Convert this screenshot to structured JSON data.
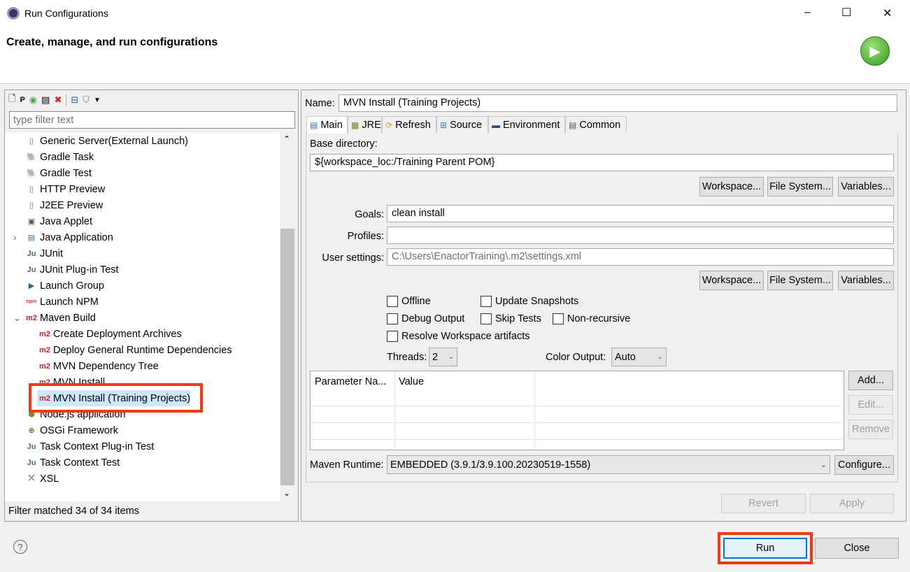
{
  "window": {
    "title": "Run Configurations",
    "minimize": "–",
    "maximize": "☐",
    "close": "✕"
  },
  "header": {
    "title": "Create, manage, and run configurations"
  },
  "left": {
    "filter_placeholder": "type filter text",
    "toolbar": [
      "new-config-icon",
      "new-prototype-icon",
      "duplicate-icon",
      "copy-icon",
      "delete-icon",
      "collapse-all-icon",
      "filter-icon",
      "dropdown-icon"
    ],
    "items": [
      {
        "label": "Generic Server(External Launch)",
        "level": 1,
        "icon": "server-icon",
        "glyph": "▯",
        "color": "#5a8a3a"
      },
      {
        "label": "Gradle Task",
        "level": 1,
        "icon": "gradle-elephant-icon",
        "glyph": "🐘",
        "color": "#02303a"
      },
      {
        "label": "Gradle Test",
        "level": 1,
        "icon": "gradle-elephant-icon",
        "glyph": "🐘",
        "color": "#1ba8cb"
      },
      {
        "label": "HTTP Preview",
        "level": 1,
        "icon": "server-icon",
        "glyph": "▯",
        "color": "#5a8a3a"
      },
      {
        "label": "J2EE Preview",
        "level": 1,
        "icon": "server-icon",
        "glyph": "▯",
        "color": "#5a8a3a"
      },
      {
        "label": "Java Applet",
        "level": 1,
        "icon": "applet-icon",
        "glyph": "▣",
        "color": "#555"
      },
      {
        "label": "Java Application",
        "level": 1,
        "icon": "java-app-icon",
        "glyph": "▤",
        "color": "#3a6ea5",
        "expander": "›"
      },
      {
        "label": "JUnit",
        "level": 1,
        "icon": "junit-icon",
        "glyph": "Ju",
        "color": "#3a6ea5"
      },
      {
        "label": "JUnit Plug-in Test",
        "level": 1,
        "icon": "junit-plugin-icon",
        "glyph": "Ju",
        "color": "#3a6ea5"
      },
      {
        "label": "Launch Group",
        "level": 1,
        "icon": "launch-group-icon",
        "glyph": "▶",
        "color": "#2a6a9a"
      },
      {
        "label": "Launch NPM",
        "level": 1,
        "icon": "npm-icon",
        "glyph": "npm",
        "color": "#cb3837"
      },
      {
        "label": "Maven Build",
        "level": 1,
        "icon": "maven-icon",
        "glyph": "m2",
        "color": "#d0202a",
        "expander": "⌄"
      },
      {
        "label": "Create Deployment Archives",
        "level": 2,
        "icon": "maven-icon",
        "glyph": "m2",
        "color": "#d0202a"
      },
      {
        "label": "Deploy General Runtime Dependencies",
        "level": 2,
        "icon": "maven-icon",
        "glyph": "m2",
        "color": "#d0202a"
      },
      {
        "label": "MVN Dependency Tree",
        "level": 2,
        "icon": "maven-icon",
        "glyph": "m2",
        "color": "#d0202a"
      },
      {
        "label": "MVN Install",
        "level": 2,
        "icon": "maven-icon",
        "glyph": "m2",
        "color": "#d0202a"
      },
      {
        "label": "MVN Install (Training Projects)",
        "level": 2,
        "icon": "maven-icon",
        "glyph": "m2",
        "color": "#d0202a",
        "selected": true
      },
      {
        "label": "Node.js application",
        "level": 1,
        "icon": "nodejs-icon",
        "glyph": "⬢",
        "color": "#6a9a2a"
      },
      {
        "label": "OSGi Framework",
        "level": 1,
        "icon": "osgi-icon",
        "glyph": "⊕",
        "color": "#8a5a2a"
      },
      {
        "label": "Task Context Plug-in Test",
        "level": 1,
        "icon": "task-context-plugin-icon",
        "glyph": "Ju",
        "color": "#3a6ea5"
      },
      {
        "label": "Task Context Test",
        "level": 1,
        "icon": "task-context-icon",
        "glyph": "Ju",
        "color": "#3a6ea5"
      },
      {
        "label": "XSL",
        "level": 1,
        "icon": "xsl-icon",
        "glyph": "⤫",
        "color": "#444"
      }
    ],
    "status": "Filter matched 34 of 34 items"
  },
  "right": {
    "name_label": "Name:",
    "name_value": "MVN Install (Training Projects)",
    "tabs": [
      {
        "label": "Main",
        "icon": "main-tab-icon"
      },
      {
        "label": "JRE",
        "icon": "jre-icon"
      },
      {
        "label": "Refresh",
        "icon": "refresh-icon"
      },
      {
        "label": "Source",
        "icon": "source-icon"
      },
      {
        "label": "Environment",
        "icon": "environment-icon"
      },
      {
        "label": "Common",
        "icon": "common-icon"
      }
    ],
    "base_dir_label": "Base directory:",
    "base_dir_value": "${workspace_loc:/Training Parent POM}",
    "workspace_btn": "Workspace...",
    "filesystem_btn": "File System...",
    "variables_btn": "Variables...",
    "goals_label": "Goals:",
    "goals_value": "clean install",
    "profiles_label": "Profiles:",
    "profiles_value": "",
    "user_settings_label": "User settings:",
    "user_settings_value": "C:\\Users\\EnactorTraining\\.m2\\settings.xml",
    "checkboxes": {
      "offline": "Offline",
      "update_snapshots": "Update Snapshots",
      "debug_output": "Debug Output",
      "skip_tests": "Skip Tests",
      "non_recursive": "Non-recursive",
      "resolve_workspace": "Resolve Workspace artifacts"
    },
    "threads_label": "Threads:",
    "threads_value": "2",
    "color_output_label": "Color Output:",
    "color_output_value": "Auto",
    "params_headers": [
      "Parameter Na...",
      "Value"
    ],
    "add_btn": "Add...",
    "edit_btn": "Edit...",
    "remove_btn": "Remove",
    "maven_runtime_label": "Maven Runtime:",
    "maven_runtime_value": "EMBEDDED (3.9.1/3.9.100.20230519-1558)",
    "configure_btn": "Configure...",
    "revert_btn": "Revert",
    "apply_btn": "Apply"
  },
  "footer": {
    "help": "?",
    "run": "Run",
    "close": "Close"
  },
  "colors": {
    "highlight": "#f03a17",
    "selection": "#cce8ff",
    "run_border": "#0078d7"
  }
}
